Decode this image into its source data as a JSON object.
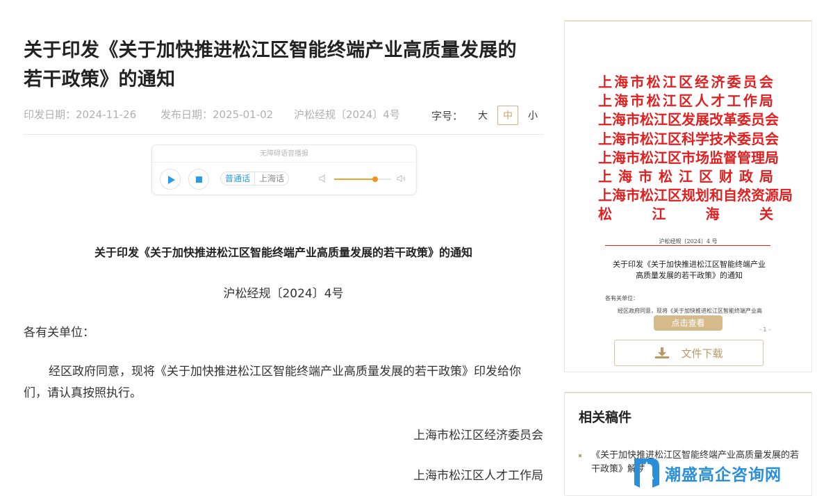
{
  "article": {
    "title_line1": "关于印发《关于加快推进松江区智能终端产业高质量发展的",
    "title_line2": "若干政策》的通知",
    "issue_date": "印发日期：2024-11-26",
    "publish_date": "发布日期：2025-01-02",
    "doc_number": "沪松经规〔2024〕4号",
    "font_size": {
      "label": "字号：",
      "large": "大",
      "medium": "中",
      "small": "小",
      "selected": "中"
    }
  },
  "player": {
    "title": "无障碍语音播报",
    "lang_mandarin": "普通话",
    "lang_shanghai": "上海话",
    "volume": 0.72,
    "accent": "#2a9be6"
  },
  "body": {
    "doc_title": "关于印发《关于加快推进松江区智能终端产业高质量发展的若干政策》的通知",
    "doc_no": "沪松经规〔2024〕4号",
    "salutation": "各有关单位：",
    "paragraph": "经区政府同意，现将《关于加快推进松江区智能终端产业高质量发展的若干政策》印发给你们，请认真按照执行。",
    "signatures": [
      "上海市松江区经济委员会",
      "上海市松江区人才工作局"
    ]
  },
  "preview": {
    "agencies": [
      "上海市松江区经济委员会",
      "上海市松江区人才工作局",
      "上海市松江区发展改革委员会",
      "上海市松江区科学技术委员会",
      "上海市松江区市场监督管理局",
      "上海市松江区财政局",
      "上海市松江区规划和自然资源局",
      "松江海关"
    ],
    "doc_no": "沪松经规〔2024〕4 号",
    "title_line1": "关于印发《关于加快推进松江区智能终端产业",
    "title_line2": "高质量发展的若干政策》的通知",
    "salutation": "各有关单位：",
    "body": "经区政府同意，现将《关于加快推进松江区智能终端产业高",
    "view_label": "点击查看",
    "page_num": "- 1 -",
    "download_label": "文件下载",
    "red": "#e02020"
  },
  "related": {
    "title": "相关稿件",
    "item": "《关于加快推进松江区智能终端产业高质量发展的若干政策》解读",
    "watermark": "潮盛高企咨询网"
  }
}
